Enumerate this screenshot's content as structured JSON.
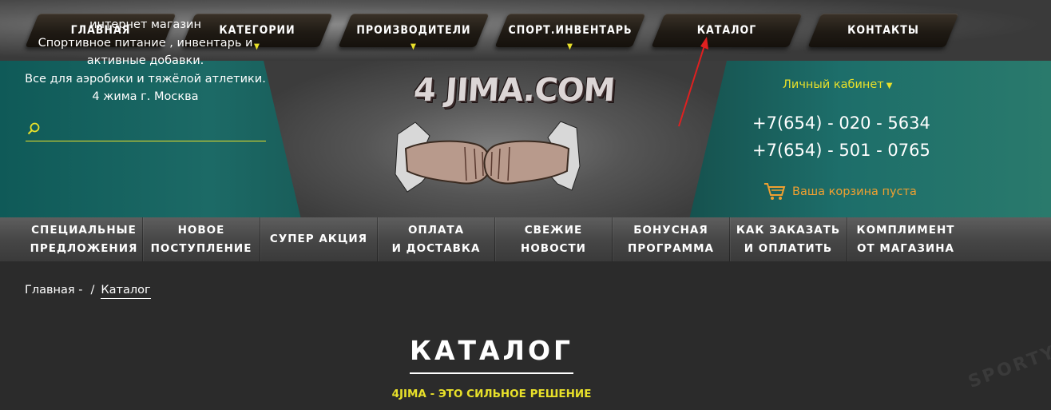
{
  "top_nav": [
    {
      "label": "ГЛАВНАЯ",
      "has_dropdown": false
    },
    {
      "label": "КАТЕГОРИИ",
      "has_dropdown": true
    },
    {
      "label": "ПРОИЗВОДИТЕЛИ",
      "has_dropdown": true
    },
    {
      "label": "СПОРТ.ИНВЕНТАРЬ",
      "has_dropdown": true
    },
    {
      "label": "КАТАЛОГ",
      "has_dropdown": false
    },
    {
      "label": "КОНТАКТЫ",
      "has_dropdown": false
    }
  ],
  "shop_description": [
    "интернет магазин",
    "Спортивное питание , инвентарь и",
    "активные добавки.",
    "Все для аэробики и тяжёлой атлетики.",
    "4 жима г. Москва"
  ],
  "search": {
    "placeholder": "",
    "value": ""
  },
  "logo": {
    "text": "4 JIMA.COM"
  },
  "account": {
    "label": "Личный кабинет"
  },
  "phones": [
    "+7(654) - 020 - 5634",
    "+7(654) - 501 - 0765"
  ],
  "cart": {
    "label": "Ваша корзина пуста"
  },
  "secondary_nav": [
    "СПЕЦИАЛЬНЫЕ\nПРЕДЛОЖЕНИЯ",
    "НОВОЕ\nПОСТУПЛЕНИЕ",
    "СУПЕР АКЦИЯ",
    "ОПЛАТА\nИ ДОСТАВКА",
    "СВЕЖИЕ\nНОВОСТИ",
    "БОНУСНАЯ\nПРОГРАММА",
    "КАК ЗАКАЗАТЬ\nИ ОПЛАТИТЬ",
    "КОМПЛИМЕНТ\nОТ МАГАЗИНА"
  ],
  "breadcrumb": {
    "home": "Главная -",
    "separator": "/",
    "current": "Каталог"
  },
  "page": {
    "title": "КАТАЛОГ",
    "slogan": "4JIMA - ЭТО СИЛЬНОЕ РЕШЕНИЕ"
  },
  "colors": {
    "accent_yellow": "#e8e02a",
    "cart_orange": "#f0a030",
    "annotation_red": "#e02020",
    "teal": "#134744"
  },
  "icons": {
    "search": "search-icon",
    "cart": "cart-icon",
    "dropdown": "chevron-down-icon"
  }
}
